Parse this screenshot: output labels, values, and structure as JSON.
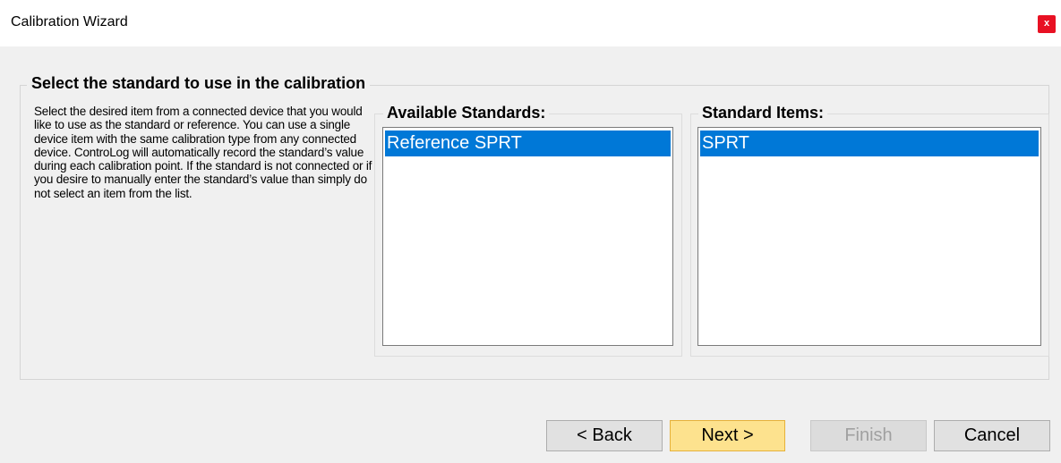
{
  "window": {
    "title": "Calibration Wizard",
    "close_label": "x"
  },
  "step": {
    "heading": "Select the standard to use in the calibration",
    "description": "Select the desired item from a connected device that you would like to use as the standard or reference.  You can use a single device item with the same calibration type from any connected device.  ControLog will automatically record the standard’s value during each calibration point.  If the standard is not connected or if you desire to manually enter the standard’s value than simply do not select an item from the list."
  },
  "available_standards": {
    "label": "Available Standards:",
    "items": [
      {
        "label": "Reference SPRT",
        "selected": true
      }
    ]
  },
  "standard_items": {
    "label": "Standard Items:",
    "items": [
      {
        "label": "SPRT",
        "selected": true
      }
    ]
  },
  "buttons": {
    "back": "< Back",
    "next": "Next >",
    "finish": "Finish",
    "cancel": "Cancel"
  },
  "colors": {
    "selection": "#0078d7",
    "default_button": "#fde28e",
    "close_button": "#e81123"
  }
}
